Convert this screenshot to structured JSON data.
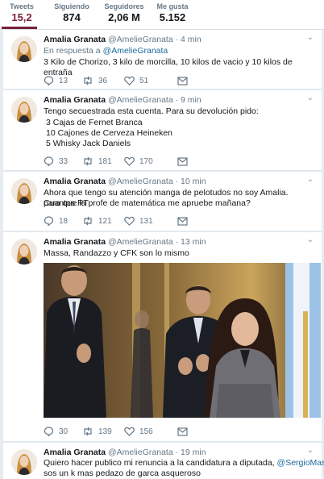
{
  "stats": {
    "tweets_label": "Tweets",
    "tweets_value": "15,2 K",
    "following_label": "Siguiendo",
    "following_value": "874",
    "followers_label": "Seguidores",
    "followers_value": "2,06 M",
    "likes_label": "Me gusta",
    "likes_value": "5.152"
  },
  "colors": {
    "accent": "#7a1f3d",
    "link": "#1b6a9c",
    "muted": "#657786"
  },
  "tweets": [
    {
      "name": "Amalia Granata",
      "handle": "@AmelieGranata",
      "time": "4 min",
      "reply_prefix": "En respuesta a",
      "reply_to": "@AmelieGranata",
      "lines": [
        "3 Kilo de Chorizo, 3 kilo de morcilla, 10 kilos de vacio y 10 kilos de entraña"
      ],
      "replies": "13",
      "retweets": "36",
      "likes": "51"
    },
    {
      "name": "Amalia Granata",
      "handle": "@AmelieGranata",
      "time": "9 min",
      "lines": [
        "Tengo secuestrada esta cuenta. Para su devolución pido:",
        "3 Cajas de Fernet Branca",
        "10 Cajones de Cerveza Heineken",
        "5 Whisky Jack Daniels"
      ],
      "replies": "33",
      "retweets": "181",
      "likes": "170"
    },
    {
      "name": "Amalia Granata",
      "handle": "@AmelieGranata",
      "time": "10 min",
      "lines": [
        "Ahora que tengo su atención manga de pelotudos no soy Amalia. Cuantos RT",
        "para que la profe de matemática me apruebe mañana?"
      ],
      "replies": "18",
      "retweets": "121",
      "likes": "131"
    },
    {
      "name": "Amalia Granata",
      "handle": "@AmelieGranata",
      "time": "13 min",
      "lines": [
        "Massa, Randazzo y CFK son lo mismo"
      ],
      "replies": "30",
      "retweets": "139",
      "likes": "156"
    },
    {
      "name": "Amalia Granata",
      "handle": "@AmelieGranata",
      "time": "19 min",
      "line1": "Quiero hacer publico mi renuncia a la candidatura a diputada,",
      "mention": "@SergioMassa",
      "line2": "sos un k mas pedazo de garca asqueroso"
    }
  ]
}
